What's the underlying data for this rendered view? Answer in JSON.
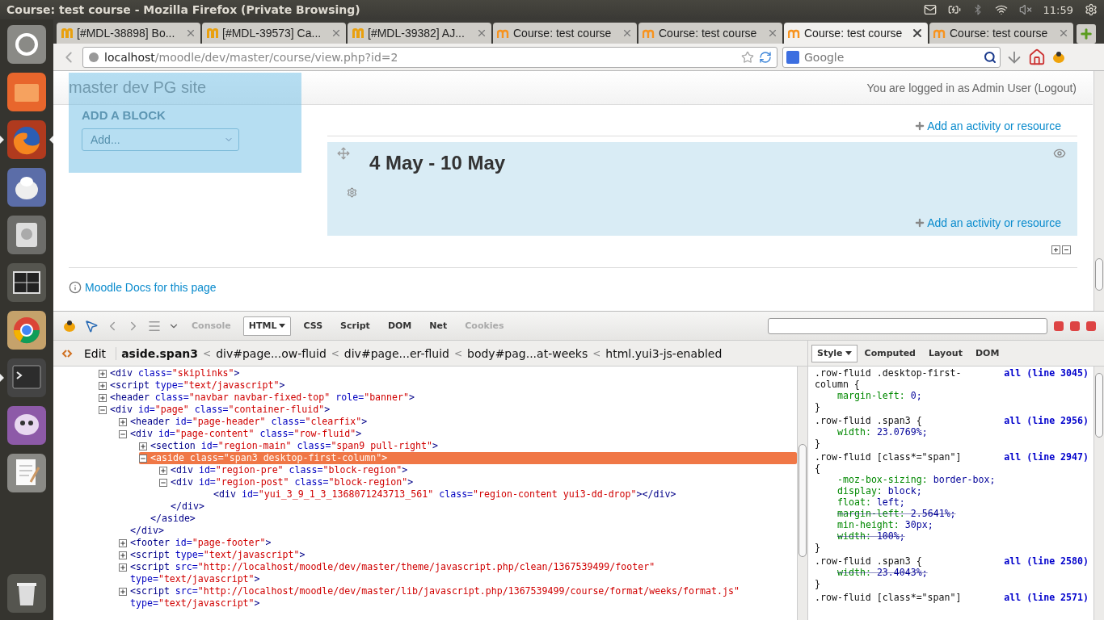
{
  "top_panel": {
    "title": "Course: test course - Mozilla Firefox (Private Browsing)",
    "time": "11:59"
  },
  "launcher": [
    {
      "running": false,
      "focused": false
    },
    {
      "running": false,
      "focused": false
    },
    {
      "running": true,
      "focused": true
    },
    {
      "running": false,
      "focused": false
    },
    {
      "running": false,
      "focused": false
    },
    {
      "running": false,
      "focused": false
    },
    {
      "running": false,
      "focused": false
    },
    {
      "running": true,
      "focused": false
    },
    {
      "running": false,
      "focused": false
    },
    {
      "running": false,
      "focused": false
    },
    {
      "running": false,
      "focused": false
    }
  ],
  "tabs": [
    {
      "label": "[#MDL-38898] Bo...",
      "kind": "tracker",
      "selected": false
    },
    {
      "label": "[#MDL-39573] Ca...",
      "kind": "tracker",
      "selected": false
    },
    {
      "label": "[#MDL-39382] AJ...",
      "kind": "tracker",
      "selected": false
    },
    {
      "label": "Course: test course",
      "kind": "moodle",
      "selected": false
    },
    {
      "label": "Course: test course",
      "kind": "moodle",
      "selected": false
    },
    {
      "label": "Course: test course",
      "kind": "moodle",
      "selected": true
    },
    {
      "label": "Course: test course",
      "kind": "moodle",
      "selected": false
    }
  ],
  "address_bar": {
    "host": "localhost",
    "path": "/moodle/dev/master/course/view.php?id=2"
  },
  "search": {
    "placeholder": "Google"
  },
  "page": {
    "site_name": "master dev PG site",
    "login_info": "You are logged in as Admin User (Logout)",
    "block_heading": "ADD A BLOCK",
    "block_select": "Add...",
    "add_activity_top": "Add an activity or resource",
    "section_title": "4 May - 10 May",
    "add_activity_bottom": "Add an activity or resource",
    "docs_link": "Moodle Docs for this page"
  },
  "firebug": {
    "tabs": [
      {
        "label": "Console",
        "disabled": true,
        "selected": false,
        "menu": false
      },
      {
        "label": "HTML",
        "disabled": false,
        "selected": true,
        "menu": true
      },
      {
        "label": "CSS",
        "disabled": false,
        "selected": false,
        "menu": false
      },
      {
        "label": "Script",
        "disabled": false,
        "selected": false,
        "menu": false
      },
      {
        "label": "DOM",
        "disabled": false,
        "selected": false,
        "menu": false
      },
      {
        "label": "Net",
        "disabled": false,
        "selected": false,
        "menu": false
      },
      {
        "label": "Cookies",
        "disabled": true,
        "selected": false,
        "menu": false
      }
    ],
    "edit_button": "Edit",
    "separator": "<",
    "breadcrumbs": [
      {
        "label": "aside.span3",
        "selected": true
      },
      {
        "label": "div#page...ow-fluid",
        "selected": false
      },
      {
        "label": "div#page...er-fluid",
        "selected": false
      },
      {
        "label": "body#pag...at-weeks",
        "selected": false
      },
      {
        "label": "html.yui3-js-enabled",
        "selected": false
      }
    ],
    "side_tabs": [
      {
        "label": "Style",
        "selected": true,
        "menu": true
      },
      {
        "label": "Computed",
        "selected": false,
        "menu": false
      },
      {
        "label": "Layout",
        "selected": false,
        "menu": false
      },
      {
        "label": "DOM",
        "selected": false,
        "menu": false
      }
    ],
    "tree": [
      {
        "line": [
          {
            "text": "<div",
            "kind": "tag"
          },
          {
            "text": " class=",
            "kind": "attr"
          },
          {
            "text": "\"skiplinks\"",
            "kind": "value"
          },
          {
            "text": ">",
            "kind": "tag"
          }
        ],
        "expanded": false,
        "selected": false
      },
      {
        "line": [
          {
            "text": "<script",
            "kind": "tag"
          },
          {
            "text": " type=",
            "kind": "attr"
          },
          {
            "text": "\"text/javascript\"",
            "kind": "value"
          },
          {
            "text": ">",
            "kind": "tag"
          }
        ],
        "expanded": false,
        "selected": false
      },
      {
        "line": [
          {
            "text": "<header",
            "kind": "tag"
          },
          {
            "text": " class=",
            "kind": "attr"
          },
          {
            "text": "\"navbar navbar-fixed-top\"",
            "kind": "value"
          },
          {
            "text": " role=",
            "kind": "attr"
          },
          {
            "text": "\"banner\"",
            "kind": "value"
          },
          {
            "text": ">",
            "kind": "tag"
          }
        ],
        "expanded": false,
        "selected": false
      },
      {
        "line": [
          {
            "text": "<div",
            "kind": "tag"
          },
          {
            "text": " id=",
            "kind": "attr"
          },
          {
            "text": "\"page\"",
            "kind": "value"
          },
          {
            "text": " class=",
            "kind": "attr"
          },
          {
            "text": "\"container-fluid\"",
            "kind": "value"
          },
          {
            "text": ">",
            "kind": "tag"
          }
        ],
        "expanded": true,
        "selected": false,
        "children": [
          {
            "line": [
              {
                "text": "<header",
                "kind": "tag"
              },
              {
                "text": " id=",
                "kind": "attr"
              },
              {
                "text": "\"page-header\"",
                "kind": "value"
              },
              {
                "text": " class=",
                "kind": "attr"
              },
              {
                "text": "\"clearfix\"",
                "kind": "value"
              },
              {
                "text": ">",
                "kind": "tag"
              }
            ],
            "expanded": false,
            "selected": false
          },
          {
            "line": [
              {
                "text": "<div",
                "kind": "tag"
              },
              {
                "text": " id=",
                "kind": "attr"
              },
              {
                "text": "\"page-content\"",
                "kind": "value"
              },
              {
                "text": " class=",
                "kind": "attr"
              },
              {
                "text": "\"row-fluid\"",
                "kind": "value"
              },
              {
                "text": ">",
                "kind": "tag"
              }
            ],
            "expanded": true,
            "selected": false,
            "end": [
              {
                "text": "</div>",
                "kind": "tag"
              }
            ],
            "children": [
              {
                "line": [
                  {
                    "text": "<section",
                    "kind": "tag"
                  },
                  {
                    "text": " id=",
                    "kind": "attr"
                  },
                  {
                    "text": "\"region-main\"",
                    "kind": "value"
                  },
                  {
                    "text": " class=",
                    "kind": "attr"
                  },
                  {
                    "text": "\"span9 pull-right\"",
                    "kind": "value"
                  },
                  {
                    "text": ">",
                    "kind": "tag"
                  }
                ],
                "expanded": false,
                "selected": false
              },
              {
                "line": [
                  {
                    "text": "<aside",
                    "kind": "tag"
                  },
                  {
                    "text": " class=",
                    "kind": "attr"
                  },
                  {
                    "text": "\"span3 desktop-first-column\"",
                    "kind": "value"
                  },
                  {
                    "text": ">",
                    "kind": "tag"
                  }
                ],
                "expanded": true,
                "selected": true,
                "end": [
                  {
                    "text": "</aside>",
                    "kind": "tag"
                  }
                ],
                "children": [
                  {
                    "line": [
                      {
                        "text": "<div",
                        "kind": "tag"
                      },
                      {
                        "text": " id=",
                        "kind": "attr"
                      },
                      {
                        "text": "\"region-pre\"",
                        "kind": "value"
                      },
                      {
                        "text": " class=",
                        "kind": "attr"
                      },
                      {
                        "text": "\"block-region\"",
                        "kind": "value"
                      },
                      {
                        "text": ">",
                        "kind": "tag"
                      }
                    ],
                    "expanded": false,
                    "selected": false
                  },
                  {
                    "line": [
                      {
                        "text": "<div",
                        "kind": "tag"
                      },
                      {
                        "text": " id=",
                        "kind": "attr"
                      },
                      {
                        "text": "\"region-post\"",
                        "kind": "value"
                      },
                      {
                        "text": " class=",
                        "kind": "attr"
                      },
                      {
                        "text": "\"block-region\"",
                        "kind": "value"
                      },
                      {
                        "text": ">",
                        "kind": "tag"
                      }
                    ],
                    "expanded": true,
                    "selected": false,
                    "end": [
                      {
                        "text": "</div>",
                        "kind": "tag"
                      }
                    ],
                    "children": [
                      {
                        "line": [
                          {
                            "text": "<div",
                            "kind": "tag"
                          },
                          {
                            "text": " id=",
                            "kind": "attr"
                          },
                          {
                            "text": "\"yui_3_9_1_3_1368071243713_561\"",
                            "kind": "value"
                          },
                          {
                            "text": " class=",
                            "kind": "attr"
                          },
                          {
                            "text": "\"region-content yui3-dd-drop\"",
                            "kind": "value"
                          },
                          {
                            "text": "></div>",
                            "kind": "tag"
                          }
                        ],
                        "selected": false
                      }
                    ]
                  }
                ]
              }
            ]
          },
          {
            "line": [
              {
                "text": "<footer",
                "kind": "tag"
              },
              {
                "text": " id=",
                "kind": "attr"
              },
              {
                "text": "\"page-footer\"",
                "kind": "value"
              },
              {
                "text": ">",
                "kind": "tag"
              }
            ],
            "expanded": false,
            "selected": false
          },
          {
            "line": [
              {
                "text": "<script",
                "kind": "tag"
              },
              {
                "text": " type=",
                "kind": "attr"
              },
              {
                "text": "\"text/javascript\"",
                "kind": "value"
              },
              {
                "text": ">",
                "kind": "tag"
              }
            ],
            "expanded": false,
            "selected": false
          },
          {
            "line": [
              {
                "text": "<script",
                "kind": "tag"
              },
              {
                "text": " src=",
                "kind": "attr"
              },
              {
                "text": "\"http://localhost/moodle/dev/master/theme/javascript.php/clean/1367539499/footer\"",
                "kind": "value"
              },
              {
                "text": " type=",
                "kind": "attr"
              },
              {
                "text": "\"text/javascript\"",
                "kind": "value"
              },
              {
                "text": ">",
                "kind": "tag"
              }
            ],
            "expanded": false,
            "selected": false
          },
          {
            "line": [
              {
                "text": "<script",
                "kind": "tag"
              },
              {
                "text": " src=",
                "kind": "attr"
              },
              {
                "text": "\"http://localhost/moodle/dev/master/lib/javascript.php/1367539499/course/format/weeks/format.js\"",
                "kind": "value"
              },
              {
                "text": " type=",
                "kind": "attr"
              },
              {
                "text": "\"text/javascript\"",
                "kind": "value"
              },
              {
                "text": ">",
                "kind": "tag"
              }
            ],
            "expanded": false,
            "selected": false
          }
        ]
      }
    ],
    "rules": [
      {
        "selector": ".row-fluid .desktop-first-column {",
        "source": "all (line 3045)",
        "props": [
          {
            "name": "margin-left:",
            "value": "0;",
            "overridden": false
          }
        ],
        "close": "}"
      },
      {
        "selector": ".row-fluid .span3 {",
        "source": "all (line 2956)",
        "props": [
          {
            "name": "width:",
            "value": "23.0769%;",
            "overridden": false
          }
        ],
        "close": "}"
      },
      {
        "selector": ".row-fluid [class*=\"span\"] {",
        "source": "all (line 2947)",
        "props": [
          {
            "name": "-moz-box-sizing:",
            "value": "border-box;",
            "overridden": false
          },
          {
            "name": "display:",
            "value": "block;",
            "overridden": false
          },
          {
            "name": "float:",
            "value": "left;",
            "overridden": false
          },
          {
            "name": "margin-left:",
            "value": "2.5641%;",
            "overridden": true
          },
          {
            "name": "min-height:",
            "value": "30px;",
            "overridden": false
          },
          {
            "name": "width:",
            "value": "100%;",
            "overridden": true
          }
        ],
        "close": "}"
      },
      {
        "selector": ".row-fluid .span3 {",
        "source": "all (line 2580)",
        "props": [
          {
            "name": "width:",
            "value": "23.4043%;",
            "overridden": true
          }
        ],
        "close": "}"
      },
      {
        "selector": ".row-fluid [class*=\"span\"]",
        "source": "all (line 2571)"
      }
    ]
  }
}
